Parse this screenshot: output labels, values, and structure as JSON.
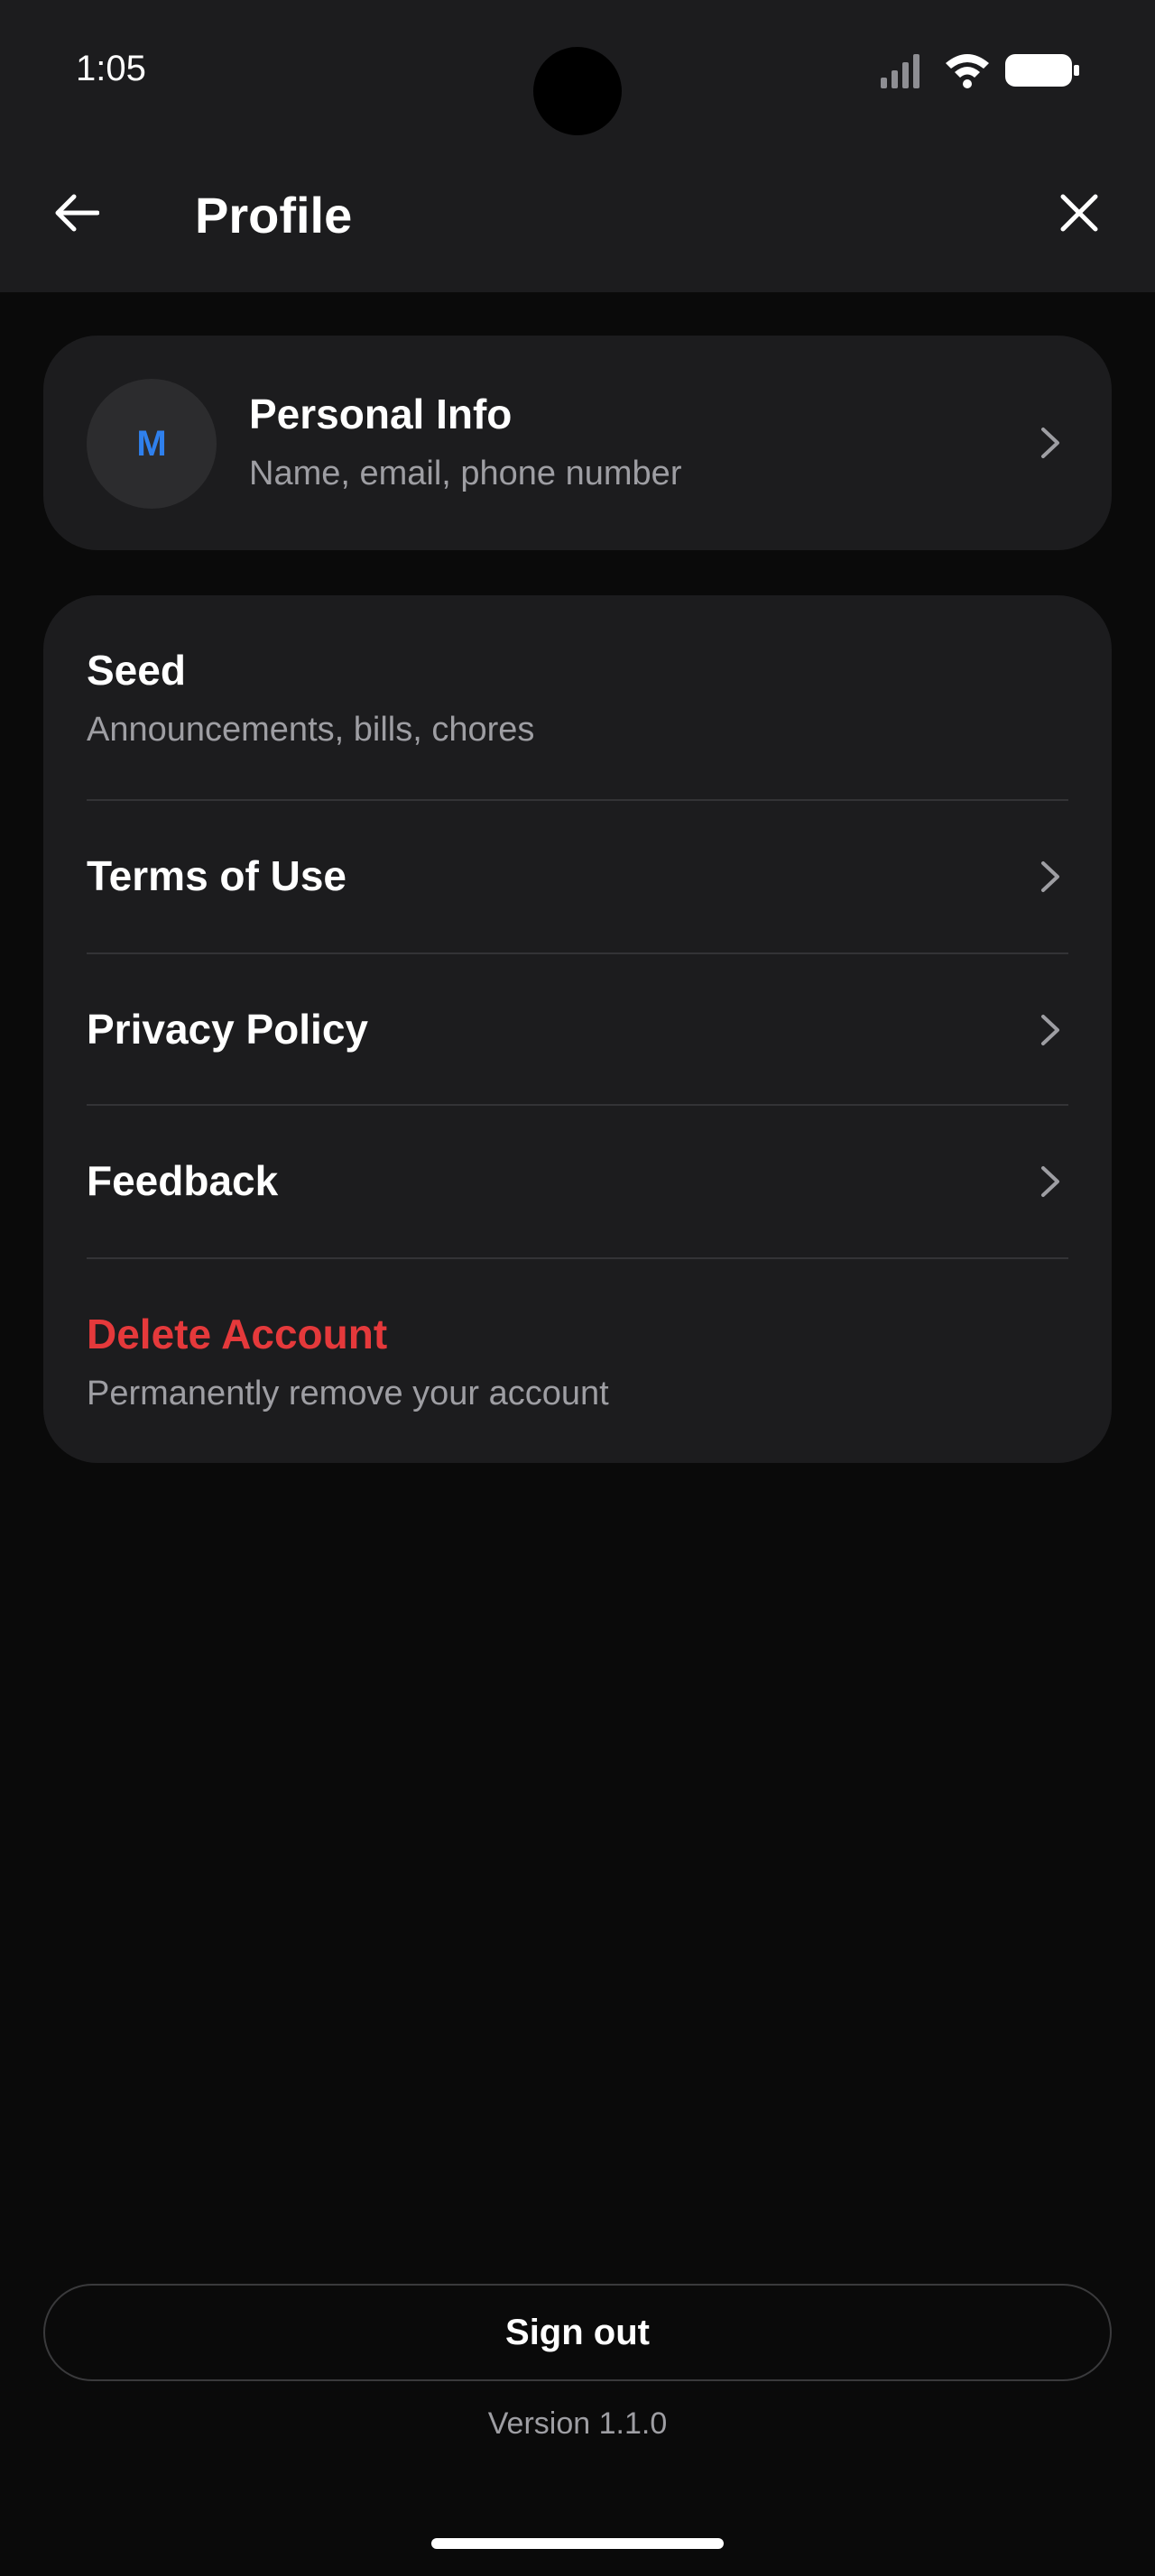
{
  "status_bar": {
    "time": "1:05",
    "icons": [
      "signal-icon",
      "wifi-icon",
      "battery-icon"
    ]
  },
  "app_bar": {
    "title": "Profile",
    "back_icon": "arrow-left-icon",
    "close_icon": "close-icon"
  },
  "personal_info": {
    "avatar_initial": "M",
    "title": "Personal Info",
    "subtitle": "Name, email, phone number"
  },
  "settings": {
    "seed": {
      "title": "Seed",
      "subtitle": "Announcements, bills, chores"
    },
    "terms": {
      "title": "Terms of Use"
    },
    "privacy": {
      "title": "Privacy Policy"
    },
    "feedback": {
      "title": "Feedback"
    },
    "delete": {
      "title": "Delete Account",
      "subtitle": "Permanently remove your account"
    }
  },
  "footer": {
    "sign_out_label": "Sign out",
    "version": "Version 1.1.0"
  },
  "colors": {
    "background": "#0a0a0a",
    "card": "#1c1c1e",
    "accent": "#2f80ed",
    "danger": "#e5393b",
    "secondary_text": "#9e9ea3"
  }
}
